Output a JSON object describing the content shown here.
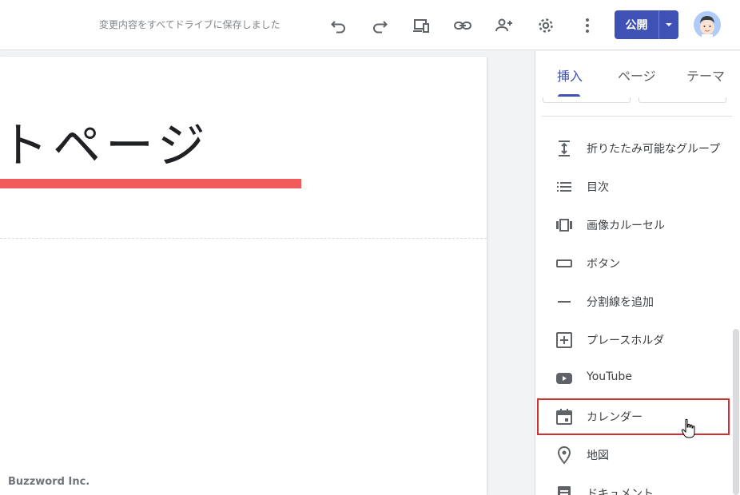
{
  "header": {
    "save_status": "変更内容をすべてドライブに保存しました",
    "publish_label": "公開",
    "icons": [
      "undo-icon",
      "redo-icon",
      "preview-icon",
      "link-icon",
      "share-icon",
      "settings-icon",
      "more-icon",
      "dropdown-icon"
    ]
  },
  "page": {
    "title": "トページ",
    "footer": "Buzzword Inc.",
    "accent_color": "#f25b5b"
  },
  "panel": {
    "tabs": [
      {
        "label": "挿入",
        "active": true
      },
      {
        "label": "ページ",
        "active": false
      },
      {
        "label": "テーマ",
        "active": false
      }
    ],
    "items": [
      {
        "label": "折りたたみ可能なグループ",
        "icon": "collapse-group-icon"
      },
      {
        "label": "目次",
        "icon": "list-icon"
      },
      {
        "label": "画像カルーセル",
        "icon": "carousel-icon"
      },
      {
        "label": "ボタン",
        "icon": "button-icon"
      },
      {
        "label": "分割線を追加",
        "icon": "divider-icon"
      },
      {
        "label": "プレースホルダ",
        "icon": "placeholder-icon"
      },
      {
        "label": "YouTube",
        "icon": "youtube-icon"
      },
      {
        "label": "カレンダー",
        "icon": "calendar-icon",
        "highlighted": true
      },
      {
        "label": "地図",
        "icon": "map-pin-icon"
      },
      {
        "label": "ドキュメント",
        "icon": "document-icon"
      }
    ],
    "primary_color": "#3f51b5",
    "highlight_color": "#d32f2f"
  }
}
